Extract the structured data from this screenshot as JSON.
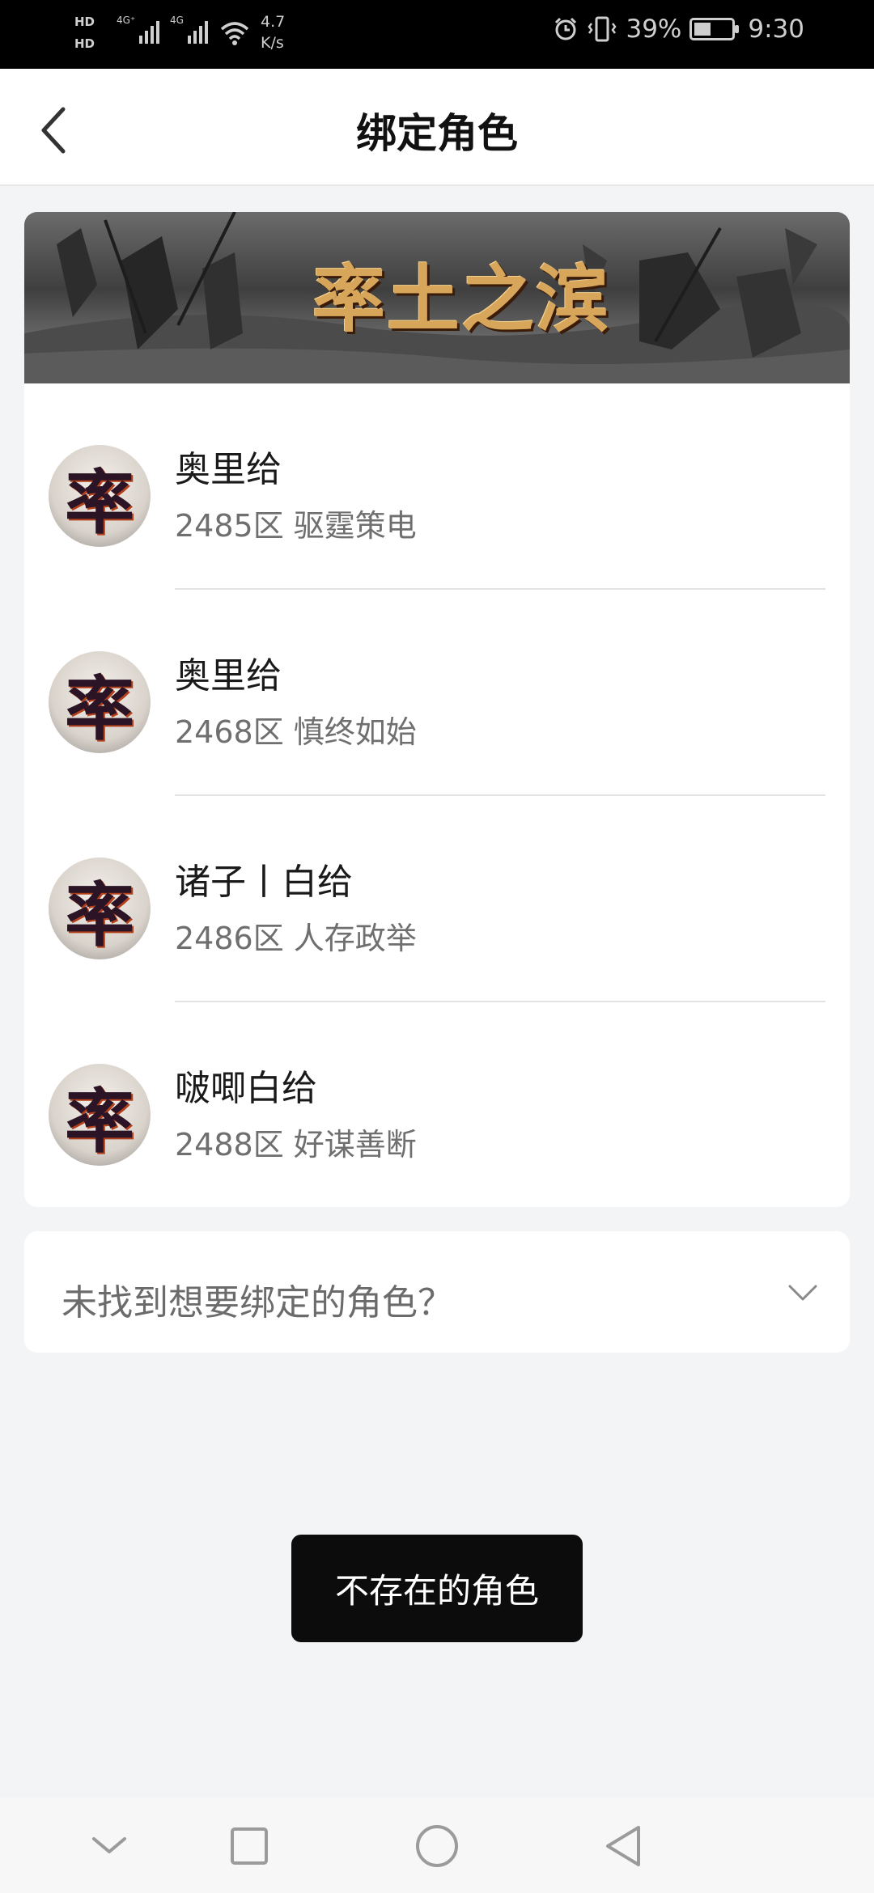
{
  "status_bar": {
    "hd1": "HD",
    "hd2": "HD",
    "net1": "4G⁺",
    "net2": "4G",
    "speed_value": "4.7",
    "speed_unit": "K/s",
    "battery_percent": "39%",
    "time": "9:30",
    "icons": [
      "signal-icon",
      "wifi-icon",
      "alarm-icon",
      "vibrate-icon",
      "battery-icon"
    ]
  },
  "header": {
    "title": "绑定角色",
    "back_icon": "chevron-left-icon"
  },
  "banner": {
    "logo_text": "率土之滨"
  },
  "roles": [
    {
      "avatar_char": "率",
      "name": "奥里给",
      "server": "2485区 驱霆策电"
    },
    {
      "avatar_char": "率",
      "name": "奥里给",
      "server": "2468区 慎终如始"
    },
    {
      "avatar_char": "率",
      "name": "诸子丨白给",
      "server": "2486区 人存政举"
    },
    {
      "avatar_char": "率",
      "name": "啵唧白给",
      "server": "2488区 好谋善断"
    }
  ],
  "not_found": {
    "label": "未找到想要绑定的角色？",
    "icon": "chevron-down-icon"
  },
  "toast": {
    "text": "不存在的角色"
  },
  "nav_bar": {
    "icons": [
      "nav-hide-icon",
      "recent-apps-icon",
      "home-icon",
      "back-icon"
    ]
  }
}
